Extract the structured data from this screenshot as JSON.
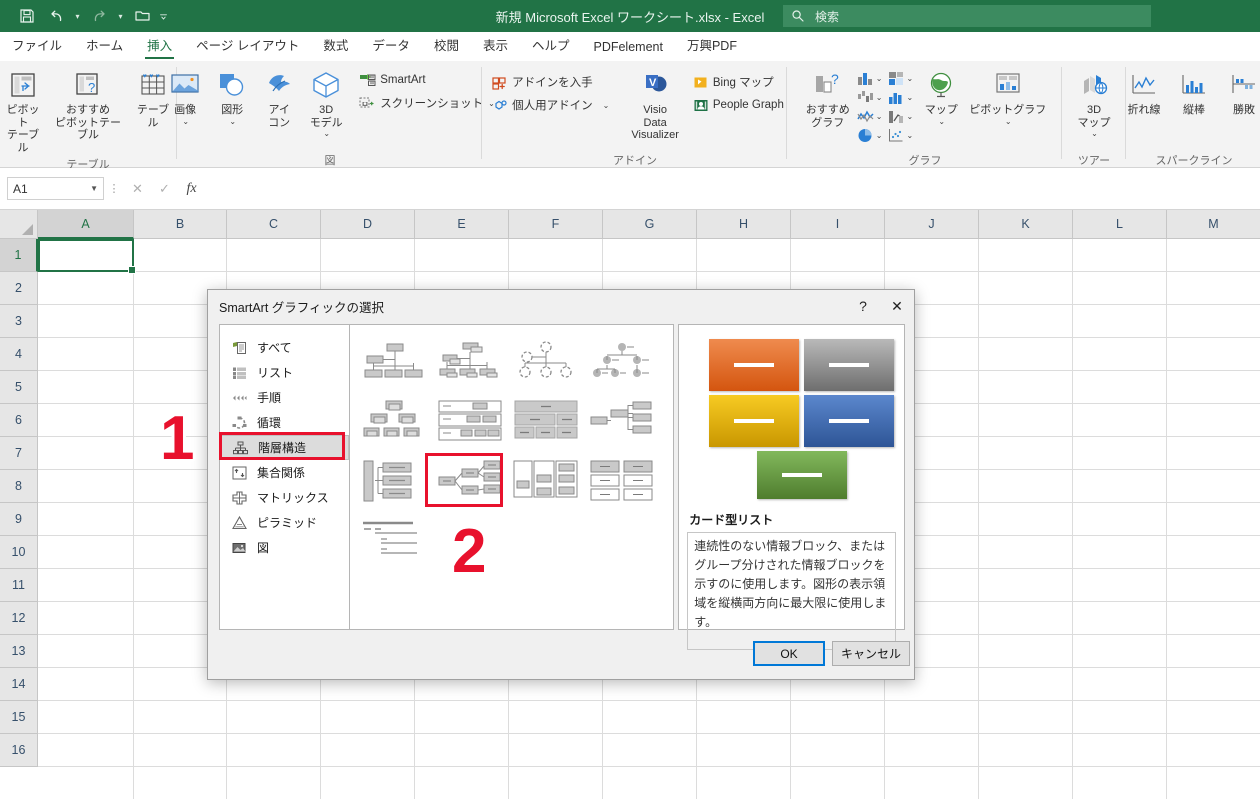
{
  "titlebar": {
    "document_title": "新規 Microsoft Excel ワークシート.xlsx  -  Excel",
    "qat": [
      {
        "name": "save-icon",
        "label": "保存"
      },
      {
        "name": "undo-icon",
        "label": "元に戻す"
      },
      {
        "name": "redo-icon",
        "label": "やり直し"
      },
      {
        "name": "open-icon",
        "label": "開く"
      },
      {
        "name": "customize-qat-icon",
        "label": "クイック アクセス ツール バーのユーザー設定"
      }
    ],
    "search": {
      "placeholder": "検索",
      "icon": "search-icon"
    }
  },
  "tabs": [
    {
      "label": "ファイル",
      "active": false
    },
    {
      "label": "ホーム",
      "active": false
    },
    {
      "label": "挿入",
      "active": true
    },
    {
      "label": "ページ レイアウト",
      "active": false
    },
    {
      "label": "数式",
      "active": false
    },
    {
      "label": "データ",
      "active": false
    },
    {
      "label": "校閲",
      "active": false
    },
    {
      "label": "表示",
      "active": false
    },
    {
      "label": "ヘルプ",
      "active": false
    },
    {
      "label": "PDFelement",
      "active": false
    },
    {
      "label": "万興PDF",
      "active": false
    }
  ],
  "ribbon": {
    "groups": [
      {
        "name": "テーブル",
        "buttons": [
          {
            "label": "ピボット\nテーブル",
            "icon": "pivot-table-icon"
          },
          {
            "label": "おすすめ\nピボットテーブル",
            "icon": "recommended-pivot-table-icon"
          },
          {
            "label": "テーブル",
            "icon": "table-icon"
          }
        ]
      },
      {
        "name": "図",
        "buttons": [
          {
            "label": "画像",
            "icon": "picture-icon",
            "caret": true
          },
          {
            "label": "図形",
            "icon": "shapes-icon",
            "caret": true
          },
          {
            "label": "アイ\nコン",
            "icon": "icons-icon"
          },
          {
            "label": "3D\nモデル",
            "icon": "3d-model-icon",
            "caret": true
          }
        ],
        "small_buttons": [
          {
            "label": "SmartArt",
            "icon": "smartart-icon"
          },
          {
            "label": "スクリーンショット",
            "icon": "screenshot-icon",
            "caret": true
          }
        ]
      },
      {
        "name": "アドイン",
        "small_buttons": [
          {
            "label": "アドインを入手",
            "icon": "get-addins-icon"
          },
          {
            "label": "個人用アドイン",
            "icon": "my-addins-icon",
            "caret": true
          },
          {
            "label": "Bing マップ",
            "icon": "bing-maps-icon"
          },
          {
            "label": "People Graph",
            "icon": "people-graph-icon"
          }
        ],
        "buttons": [
          {
            "label": "Visio Data\nVisualizer",
            "icon": "visio-data-visualizer-icon"
          }
        ]
      },
      {
        "name": "グラフ",
        "buttons": [
          {
            "label": "おすすめ\nグラフ",
            "icon": "recommended-charts-icon"
          }
        ],
        "chart_icons": [
          {
            "icon": "column-chart-icon"
          },
          {
            "icon": "waterfall-chart-icon"
          },
          {
            "icon": "hierarchy-chart-icon"
          },
          {
            "icon": "statistic-chart-icon"
          },
          {
            "icon": "line-chart-icon"
          },
          {
            "icon": "bar-chart-icon"
          },
          {
            "icon": "pie-chart-icon"
          },
          {
            "icon": "scatter-chart-icon"
          }
        ],
        "more_buttons": [
          {
            "label": "マップ",
            "icon": "map-chart-icon",
            "caret": true
          },
          {
            "label": "ピボットグラフ",
            "icon": "pivot-chart-icon",
            "caret": true
          }
        ],
        "dialog_launcher": "chart-dialog-launcher"
      },
      {
        "name": "ツアー",
        "buttons": [
          {
            "label": "3D\nマップ",
            "icon": "3d-map-icon",
            "caret": true
          }
        ]
      },
      {
        "name": "スパークライン",
        "buttons": [
          {
            "label": "折れ線",
            "icon": "sparkline-line-icon"
          },
          {
            "label": "縦棒",
            "icon": "sparkline-column-icon"
          },
          {
            "label": "勝敗",
            "icon": "sparkline-winloss-icon"
          }
        ]
      }
    ]
  },
  "formula_bar": {
    "name_box_value": "A1",
    "cancel_icon": "cancel-icon",
    "enter_icon": "enter-icon",
    "function_icon": "insert-function-icon",
    "formula_value": ""
  },
  "grid": {
    "columns": [
      "A",
      "B",
      "C",
      "D",
      "E",
      "F",
      "G",
      "H",
      "I",
      "J",
      "K",
      "L",
      "M"
    ],
    "rows": [
      "1",
      "2",
      "3",
      "4",
      "5",
      "6",
      "7",
      "8",
      "9",
      "10",
      "11",
      "12",
      "13",
      "14",
      "15",
      "16"
    ],
    "active_cell": "A1"
  },
  "dialog": {
    "title": "SmartArt グラフィックの選択",
    "help_icon": "help-icon",
    "close_icon": "close-icon",
    "categories": [
      {
        "label": "すべて",
        "icon": "all-icon",
        "selected": false
      },
      {
        "label": "リスト",
        "icon": "list-icon",
        "selected": false
      },
      {
        "label": "手順",
        "icon": "process-icon",
        "selected": false
      },
      {
        "label": "循環",
        "icon": "cycle-icon",
        "selected": false
      },
      {
        "label": "階層構造",
        "icon": "hierarchy-icon",
        "selected": true
      },
      {
        "label": "集合関係",
        "icon": "relationship-icon",
        "selected": false
      },
      {
        "label": "マトリックス",
        "icon": "matrix-icon",
        "selected": false
      },
      {
        "label": "ピラミッド",
        "icon": "pyramid-icon",
        "selected": false
      },
      {
        "label": "図",
        "icon": "picture-category-icon",
        "selected": false
      }
    ],
    "gallery_selected_index": 10,
    "preview": {
      "name": "カード型リスト",
      "description": "連続性のない情報ブロック、またはグループ分けされた情報ブロックを示すのに使用します。図形の表示領域を縦横両方向に最大限に使用します。",
      "cards": [
        {
          "color_top": "#ef8b4e",
          "color_bottom": "#d4550f"
        },
        {
          "color_top": "#b5b5b5",
          "color_bottom": "#6e6e6e"
        },
        {
          "color_top": "#f5c518",
          "color_bottom": "#c99700"
        },
        {
          "color_top": "#5b87cd",
          "color_bottom": "#2e5596"
        },
        {
          "color_top": "#7fb35a",
          "color_bottom": "#4f7d2e"
        }
      ]
    },
    "buttons": {
      "ok": "OK",
      "cancel": "キャンセル"
    }
  },
  "annotations": [
    {
      "label": "1",
      "target": "sidebar-category-hierarchy"
    },
    {
      "label": "2",
      "target": "gallery-item-card-list"
    }
  ],
  "colors": {
    "excel_green": "#217346",
    "annotation_red": "#e8112d",
    "focus_blue": "#0078d7"
  }
}
